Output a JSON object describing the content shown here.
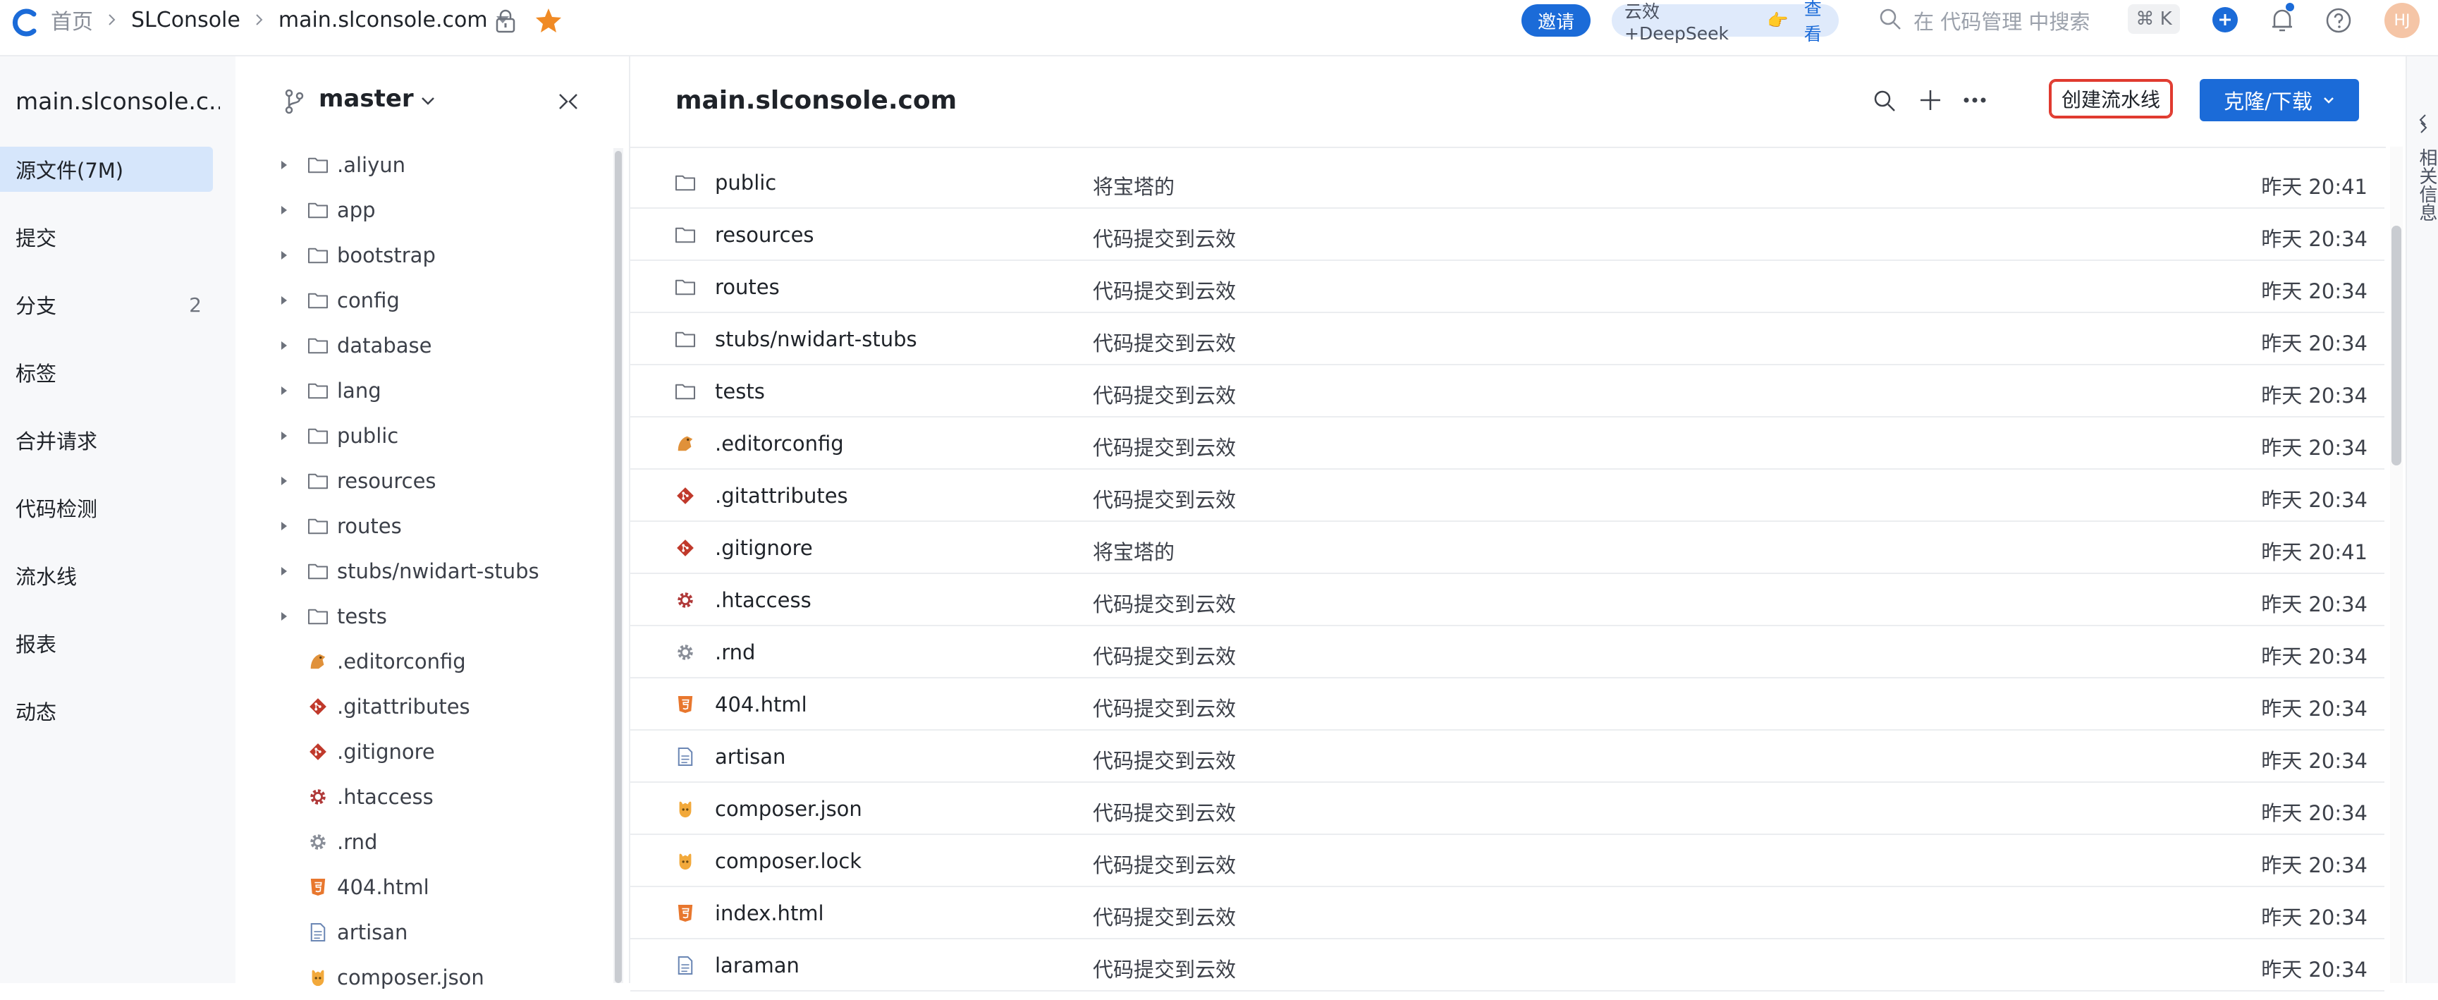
{
  "header": {
    "breadcrumbs": [
      "首页",
      "SLConsole",
      "main.slconsole.com"
    ],
    "invite_label": "邀请",
    "promo_text": "云效+DeepSeek",
    "promo_view": "查看",
    "search_placeholder": "在 代码管理 中搜索",
    "shortcut": "⌘ K",
    "avatar_initials": "HJ",
    "accent": "#1b6bd8"
  },
  "sidebar": {
    "repo_name": "main.slconsole.c...",
    "items": [
      {
        "label": "源文件(7M)",
        "active": true
      },
      {
        "label": "提交"
      },
      {
        "label": "分支",
        "count": "2"
      },
      {
        "label": "标签"
      },
      {
        "label": "合并请求"
      },
      {
        "label": "代码检测"
      },
      {
        "label": "流水线"
      },
      {
        "label": "报表"
      },
      {
        "label": "动态"
      }
    ]
  },
  "tree": {
    "branch": "master",
    "items": [
      {
        "name": ".aliyun",
        "icon": "folder-icon",
        "expandable": true
      },
      {
        "name": "app",
        "icon": "folder-icon",
        "expandable": true
      },
      {
        "name": "bootstrap",
        "icon": "folder-icon",
        "expandable": true
      },
      {
        "name": "config",
        "icon": "folder-icon",
        "expandable": true
      },
      {
        "name": "database",
        "icon": "folder-icon",
        "expandable": true
      },
      {
        "name": "lang",
        "icon": "folder-icon",
        "expandable": true
      },
      {
        "name": "public",
        "icon": "folder-icon",
        "expandable": true
      },
      {
        "name": "resources",
        "icon": "folder-icon",
        "expandable": true
      },
      {
        "name": "routes",
        "icon": "folder-icon",
        "expandable": true
      },
      {
        "name": "stubs/nwidart-stubs",
        "icon": "folder-icon",
        "expandable": true
      },
      {
        "name": "tests",
        "icon": "folder-icon",
        "expandable": true
      },
      {
        "name": ".editorconfig",
        "icon": "editorconfig-icon"
      },
      {
        "name": ".gitattributes",
        "icon": "git-icon"
      },
      {
        "name": ".gitignore",
        "icon": "git-icon"
      },
      {
        "name": ".htaccess",
        "icon": "gear-red-icon"
      },
      {
        "name": ".rnd",
        "icon": "gear-grey-icon"
      },
      {
        "name": "404.html",
        "icon": "html5-icon"
      },
      {
        "name": "artisan",
        "icon": "file-icon"
      },
      {
        "name": "composer.json",
        "icon": "composer-icon"
      }
    ]
  },
  "main": {
    "title": "main.slconsole.com",
    "create_pipeline_label": "创建流水线",
    "clone_label": "克隆/下载",
    "files": [
      {
        "name": "public",
        "icon": "folder-icon",
        "message": "将宝塔的",
        "time": "昨天 20:41"
      },
      {
        "name": "resources",
        "icon": "folder-icon",
        "message": "代码提交到云效",
        "time": "昨天 20:34"
      },
      {
        "name": "routes",
        "icon": "folder-icon",
        "message": "代码提交到云效",
        "time": "昨天 20:34"
      },
      {
        "name": "stubs/nwidart-stubs",
        "icon": "folder-icon",
        "message": "代码提交到云效",
        "time": "昨天 20:34"
      },
      {
        "name": "tests",
        "icon": "folder-icon",
        "message": "代码提交到云效",
        "time": "昨天 20:34"
      },
      {
        "name": ".editorconfig",
        "icon": "editorconfig-icon",
        "message": "代码提交到云效",
        "time": "昨天 20:34"
      },
      {
        "name": ".gitattributes",
        "icon": "git-icon",
        "message": "代码提交到云效",
        "time": "昨天 20:34"
      },
      {
        "name": ".gitignore",
        "icon": "git-icon",
        "message": "将宝塔的",
        "time": "昨天 20:41"
      },
      {
        "name": ".htaccess",
        "icon": "gear-red-icon",
        "message": "代码提交到云效",
        "time": "昨天 20:34"
      },
      {
        "name": ".rnd",
        "icon": "gear-grey-icon",
        "message": "代码提交到云效",
        "time": "昨天 20:34"
      },
      {
        "name": "404.html",
        "icon": "html5-icon",
        "message": "代码提交到云效",
        "time": "昨天 20:34"
      },
      {
        "name": "artisan",
        "icon": "file-icon",
        "message": "代码提交到云效",
        "time": "昨天 20:34"
      },
      {
        "name": "composer.json",
        "icon": "composer-icon",
        "message": "代码提交到云效",
        "time": "昨天 20:34"
      },
      {
        "name": "composer.lock",
        "icon": "composer-icon",
        "message": "代码提交到云效",
        "time": "昨天 20:34"
      },
      {
        "name": "index.html",
        "icon": "html5-icon",
        "message": "代码提交到云效",
        "time": "昨天 20:34"
      },
      {
        "name": "laraman",
        "icon": "file-icon",
        "message": "代码提交到云效",
        "time": "昨天 20:34"
      }
    ]
  },
  "right_panel": {
    "label": "相关信息"
  }
}
